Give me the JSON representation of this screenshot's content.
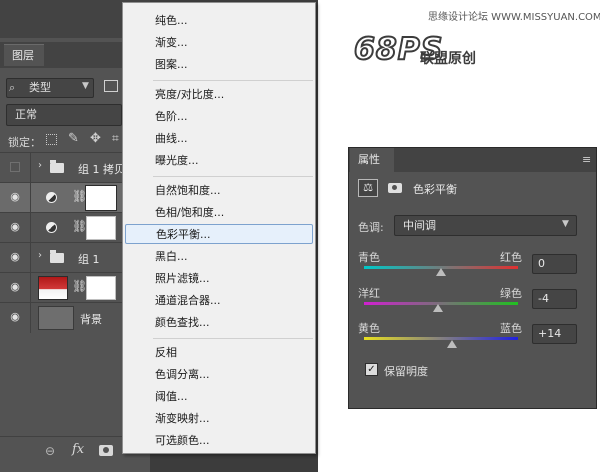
{
  "watermark": "思缘设计论坛 WWW.MISSYUAN.COM",
  "logo": {
    "main": "68PS",
    "sub": "联盟原创"
  },
  "layers_panel": {
    "tab": "图层",
    "kind_select": "类型",
    "blend_mode": "正常",
    "lock_label": "锁定：",
    "layers": [
      {
        "name": "组 1 拷贝",
        "type": "group",
        "visible": false
      },
      {
        "name": "",
        "type": "adjustment",
        "visible": true,
        "selected": true
      },
      {
        "name": "",
        "type": "adjustment",
        "visible": true
      },
      {
        "name": "组 1",
        "type": "group",
        "visible": true
      },
      {
        "name": "",
        "type": "photo",
        "visible": true
      },
      {
        "name": "背景",
        "type": "background",
        "visible": true
      }
    ]
  },
  "adjustment_menu": {
    "groups": [
      [
        "纯色...",
        "渐变...",
        "图案..."
      ],
      [
        "亮度/对比度...",
        "色阶...",
        "曲线...",
        "曝光度..."
      ],
      [
        "自然饱和度...",
        "色相/饱和度...",
        "色彩平衡...",
        "黑白...",
        "照片滤镜...",
        "通道混合器...",
        "颜色查找..."
      ],
      [
        "反相",
        "色调分离...",
        "阈值...",
        "渐变映射...",
        "可选颜色..."
      ]
    ],
    "highlighted": "色彩平衡..."
  },
  "properties_panel": {
    "tab": "属性",
    "title": "色彩平衡",
    "tone_label": "色调:",
    "tone_value": "中间调",
    "sliders": [
      {
        "left": "青色",
        "right": "红色",
        "value": "0",
        "amount": 0,
        "gradient": [
          "#00c8c8",
          "#e03030"
        ]
      },
      {
        "left": "洋红",
        "right": "绿色",
        "value": "-4",
        "amount": -4,
        "gradient": [
          "#d020d0",
          "#20c020"
        ]
      },
      {
        "left": "黄色",
        "right": "蓝色",
        "value": "+14",
        "amount": 14,
        "gradient": [
          "#e8e020",
          "#2020e0"
        ]
      }
    ],
    "preserve_luminosity": {
      "label": "保留明度",
      "checked": true
    }
  }
}
